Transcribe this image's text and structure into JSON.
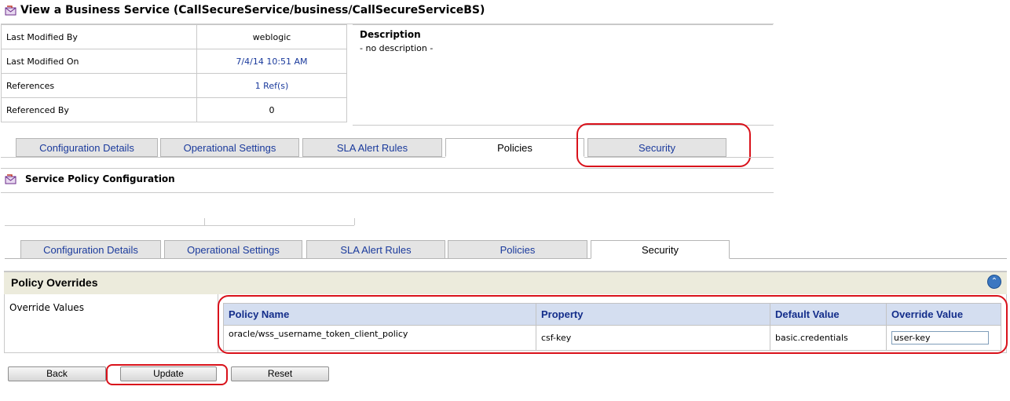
{
  "page_title": "View a Business Service (CallSecureService/business/CallSecureServiceBS)",
  "properties": [
    {
      "label": "Last Modified By",
      "value": "weblogic"
    },
    {
      "label": "Last Modified On",
      "value": "7/4/14 10:51 AM"
    },
    {
      "label": "References",
      "value": "1 Ref(s)"
    },
    {
      "label": "Referenced By",
      "value": "0"
    }
  ],
  "description": {
    "heading": "Description",
    "text": "- no description -"
  },
  "tabs_top": [
    {
      "label": "Configuration Details"
    },
    {
      "label": "Operational Settings"
    },
    {
      "label": "SLA Alert Rules"
    },
    {
      "label": "Policies",
      "active": true
    },
    {
      "label": "Security"
    }
  ],
  "section_title": "Service Policy Configuration",
  "tabs_bottom": [
    {
      "label": "Configuration Details"
    },
    {
      "label": "Operational Settings"
    },
    {
      "label": "SLA Alert Rules"
    },
    {
      "label": "Policies"
    },
    {
      "label": "Security",
      "active": true
    }
  ],
  "policy_overrides": {
    "title": "Policy Overrides",
    "row_label": "Override Values",
    "columns": [
      "Policy Name",
      "Property",
      "Default Value",
      "Override Value"
    ],
    "rows": [
      {
        "policy_name": "oracle/wss_username_token_client_policy",
        "property": "csf-key",
        "default_value": "basic.credentials",
        "override_value": "user-key"
      }
    ]
  },
  "buttons": {
    "back": "Back",
    "update": "Update",
    "reset": "Reset"
  },
  "colors": {
    "link": "#1a3a9c",
    "annotation_red": "#d9121b",
    "header_blue": "#d4def0"
  }
}
